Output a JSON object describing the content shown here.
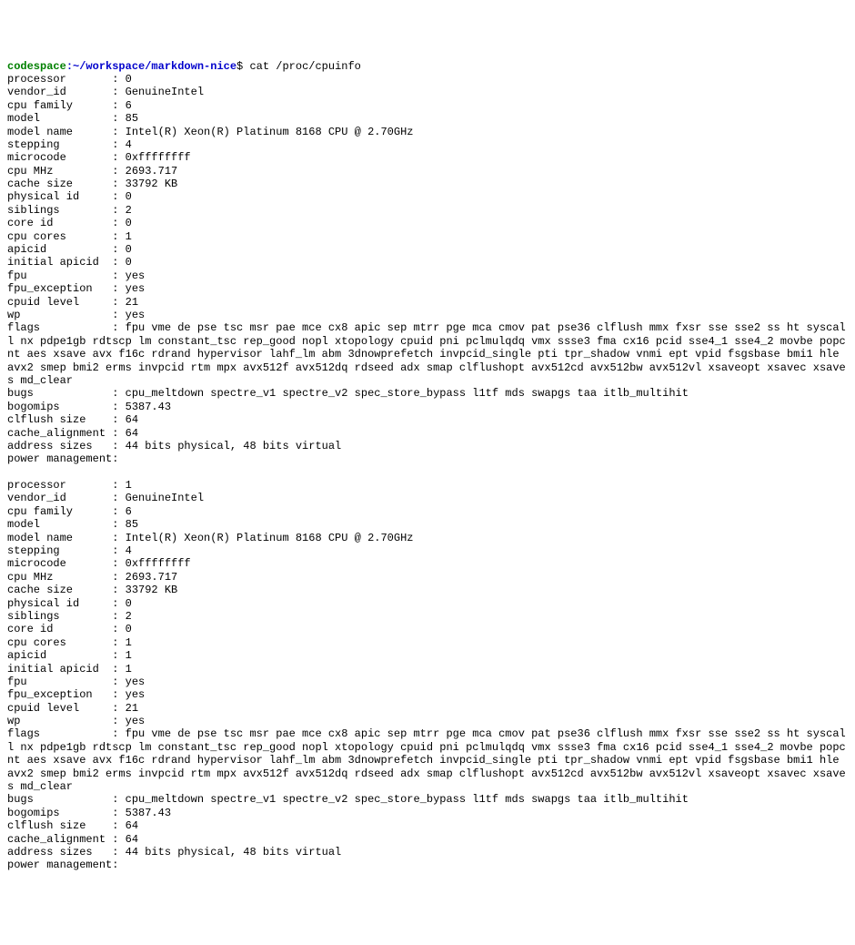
{
  "prompt": {
    "user": "codespace",
    "separator": ":",
    "path": "~/workspace/markdown-nice",
    "symbol": "$",
    "command": "cat /proc/cpuinfo"
  },
  "processors": [
    {
      "processor": "0",
      "vendor_id": "GenuineIntel",
      "cpu_family": "6",
      "model": "85",
      "model_name": "Intel(R) Xeon(R) Platinum 8168 CPU @ 2.70GHz",
      "stepping": "4",
      "microcode": "0xffffffff",
      "cpu_MHz": "2693.717",
      "cache_size": "33792 KB",
      "physical_id": "0",
      "siblings": "2",
      "core_id": "0",
      "cpu_cores": "1",
      "apicid": "0",
      "initial_apicid": "0",
      "fpu": "yes",
      "fpu_exception": "yes",
      "cpuid_level": "21",
      "wp": "yes",
      "flags": "fpu vme de pse tsc msr pae mce cx8 apic sep mtrr pge mca cmov pat pse36 clflush mmx fxsr sse sse2 ss ht syscall nx pdpe1gb rdtscp lm constant_tsc rep_good nopl xtopology cpuid pni pclmulqdq vmx ssse3 fma cx16 pcid sse4_1 sse4_2 movbe popcnt aes xsave avx f16c rdrand hypervisor lahf_lm abm 3dnowprefetch invpcid_single pti tpr_shadow vnmi ept vpid fsgsbase bmi1 hle avx2 smep bmi2 erms invpcid rtm mpx avx512f avx512dq rdseed adx smap clflushopt avx512cd avx512bw avx512vl xsaveopt xsavec xsaves md_clear",
      "bugs": "cpu_meltdown spectre_v1 spectre_v2 spec_store_bypass l1tf mds swapgs taa itlb_multihit",
      "bogomips": "5387.43",
      "clflush_size": "64",
      "cache_alignment": "64",
      "address_sizes": "44 bits physical, 48 bits virtual",
      "power_management": ""
    },
    {
      "processor": "1",
      "vendor_id": "GenuineIntel",
      "cpu_family": "6",
      "model": "85",
      "model_name": "Intel(R) Xeon(R) Platinum 8168 CPU @ 2.70GHz",
      "stepping": "4",
      "microcode": "0xffffffff",
      "cpu_MHz": "2693.717",
      "cache_size": "33792 KB",
      "physical_id": "0",
      "siblings": "2",
      "core_id": "0",
      "cpu_cores": "1",
      "apicid": "1",
      "initial_apicid": "1",
      "fpu": "yes",
      "fpu_exception": "yes",
      "cpuid_level": "21",
      "wp": "yes",
      "flags": "fpu vme de pse tsc msr pae mce cx8 apic sep mtrr pge mca cmov pat pse36 clflush mmx fxsr sse sse2 ss ht syscall nx pdpe1gb rdtscp lm constant_tsc rep_good nopl xtopology cpuid pni pclmulqdq vmx ssse3 fma cx16 pcid sse4_1 sse4_2 movbe popcnt aes xsave avx f16c rdrand hypervisor lahf_lm abm 3dnowprefetch invpcid_single pti tpr_shadow vnmi ept vpid fsgsbase bmi1 hle avx2 smep bmi2 erms invpcid rtm mpx avx512f avx512dq rdseed adx smap clflushopt avx512cd avx512bw avx512vl xsaveopt xsavec xsaves md_clear",
      "bugs": "cpu_meltdown spectre_v1 spectre_v2 spec_store_bypass l1tf mds swapgs taa itlb_multihit",
      "bogomips": "5387.43",
      "clflush_size": "64",
      "cache_alignment": "64",
      "address_sizes": "44 bits physical, 48 bits virtual",
      "power_management": ""
    }
  ],
  "labels": {
    "processor": "processor",
    "vendor_id": "vendor_id",
    "cpu_family": "cpu family",
    "model": "model",
    "model_name": "model name",
    "stepping": "stepping",
    "microcode": "microcode",
    "cpu_MHz": "cpu MHz",
    "cache_size": "cache size",
    "physical_id": "physical id",
    "siblings": "siblings",
    "core_id": "core id",
    "cpu_cores": "cpu cores",
    "apicid": "apicid",
    "initial_apicid": "initial apicid",
    "fpu": "fpu",
    "fpu_exception": "fpu_exception",
    "cpuid_level": "cpuid level",
    "wp": "wp",
    "flags": "flags",
    "bugs": "bugs",
    "bogomips": "bogomips",
    "clflush_size": "clflush size",
    "cache_alignment": "cache_alignment",
    "address_sizes": "address sizes",
    "power_management": "power management"
  }
}
